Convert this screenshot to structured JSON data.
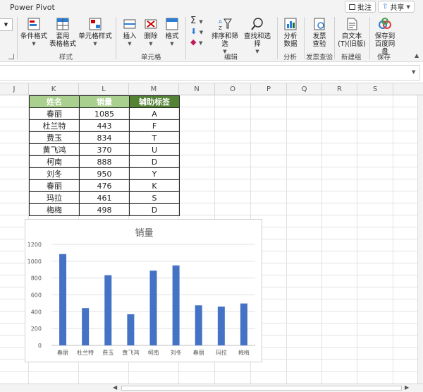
{
  "ribbon": {
    "tab_label": "Power Pivot",
    "comment_label": "批注",
    "share_label": "共享",
    "groups": {
      "styles": {
        "label": "样式",
        "conditional": "条件格式",
        "table_format_1": "套用",
        "table_format_2": "表格格式",
        "cell_style": "单元格样式"
      },
      "cells": {
        "label": "单元格",
        "insert": "插入",
        "delete": "删除",
        "format": "格式"
      },
      "editing": {
        "label": "编辑",
        "sort_filter": "排序和筛选",
        "find_select": "查找和选择"
      },
      "analysis": {
        "label": "分析",
        "analyze_1": "分析",
        "analyze_2": "数据"
      },
      "invoice": {
        "label": "发票查验",
        "check_1": "发票",
        "check_2": "查验"
      },
      "new_group": {
        "label": "新建组",
        "doc_1": "自文本",
        "doc_2": "(T)(旧版)"
      },
      "save": {
        "label": "保存",
        "save_1": "保存到",
        "save_2": "百度网盘"
      }
    },
    "accent_colors": {
      "excel_green": "#217346",
      "share_icon": "#2b7cd3"
    }
  },
  "columns": [
    "J",
    "K",
    "L",
    "M",
    "N",
    "O",
    "P",
    "Q",
    "R",
    "S"
  ],
  "table": {
    "headers": [
      "姓名",
      "销量",
      "辅助标签"
    ],
    "header_colors": [
      "#a9d08e",
      "#a9d08e",
      "#548235"
    ],
    "rows": [
      [
        "春丽",
        "1085",
        "A"
      ],
      [
        "杜兰特",
        "443",
        "F"
      ],
      [
        "费玉",
        "834",
        "T"
      ],
      [
        "黄飞鸿",
        "370",
        "U"
      ],
      [
        "柯南",
        "888",
        "D"
      ],
      [
        "刘冬",
        "950",
        "Y"
      ],
      [
        "春丽",
        "476",
        "K"
      ],
      [
        "玛拉",
        "461",
        "S"
      ],
      [
        "梅梅",
        "498",
        "D"
      ]
    ]
  },
  "chart_data": {
    "type": "bar",
    "title": "销量",
    "categories": [
      "春丽",
      "杜兰特",
      "费玉",
      "黄飞鸿",
      "柯南",
      "刘冬",
      "春丽",
      "玛拉",
      "梅梅"
    ],
    "values": [
      1085,
      443,
      834,
      370,
      888,
      950,
      476,
      461,
      498
    ],
    "ylim": [
      0,
      1200
    ],
    "yticks": [
      0,
      200,
      400,
      600,
      800,
      1000,
      1200
    ],
    "grid": true,
    "bar_color": "#4472c4"
  }
}
